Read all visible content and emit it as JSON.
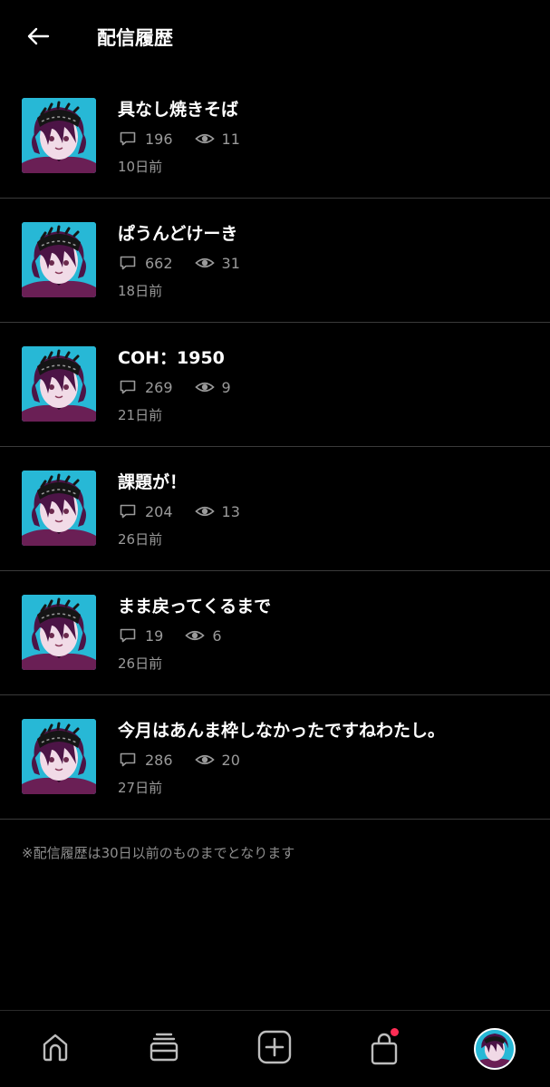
{
  "header": {
    "title": "配信履歴",
    "back_icon": "arrow-left-icon"
  },
  "broadcasts": [
    {
      "title": "具なし焼きそば",
      "comments": "196",
      "views": "11",
      "date": "10日前"
    },
    {
      "title": "ぱうんどけーき",
      "comments": "662",
      "views": "31",
      "date": "18日前"
    },
    {
      "title": "COH：1950",
      "comments": "269",
      "views": "9",
      "date": "21日前"
    },
    {
      "title": "課題が！",
      "comments": "204",
      "views": "13",
      "date": "26日前"
    },
    {
      "title": "まま戻ってくるまで",
      "comments": "19",
      "views": "6",
      "date": "26日前"
    },
    {
      "title": "今月はあんま枠しなかったですねわたし。",
      "comments": "286",
      "views": "20",
      "date": "27日前"
    }
  ],
  "note": "※配信履歴は30日以前のものまでとなります",
  "bottom_nav": {
    "items": [
      "home-icon",
      "feed-icon",
      "create-plus-icon",
      "shop-bag-icon",
      "profile-avatar"
    ],
    "badge_color": "#ff2d55"
  },
  "colors": {
    "background": "#000000",
    "thumbnail_bg": "#27b8d6",
    "muted_text": "#9a9a9a",
    "divider": "#3a3a3a"
  }
}
